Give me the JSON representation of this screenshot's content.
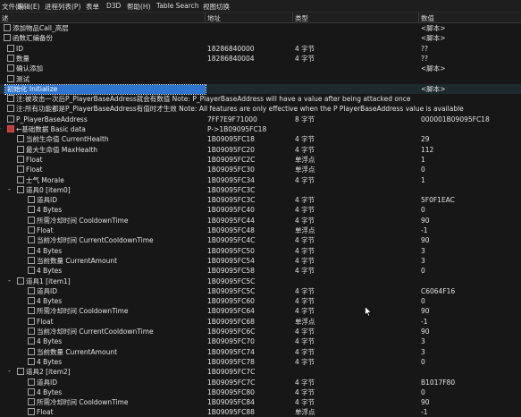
{
  "menubar": {
    "items": [
      {
        "key": "menu-file",
        "label": "文件(F)"
      },
      {
        "key": "menu-edit",
        "label": "编辑(E)"
      },
      {
        "key": "menu-process-list",
        "label": "进程列表(P)"
      },
      {
        "key": "menu-form",
        "label": "表单"
      },
      {
        "key": "menu-d3d",
        "label": "D3D"
      },
      {
        "key": "menu-help",
        "label": "帮助(H)"
      },
      {
        "key": "menu-table-search",
        "label": "Table Search"
      },
      {
        "key": "menu-view-switch",
        "label": "视图切换"
      }
    ]
  },
  "columns": {
    "desc": "述",
    "address": "地址",
    "type": "类型",
    "value": "数值"
  },
  "rows": [
    {
      "desc": "添加物品Call_高层",
      "addr": "",
      "type": "",
      "val": "<脚本>",
      "cb": "unchecked",
      "exp": ""
    },
    {
      "desc": "函数汇编备份",
      "addr": "",
      "type": "",
      "val": "<脚本>",
      "cb": "unchecked",
      "exp": ""
    },
    {
      "desc": "ID",
      "addr": "18286840000",
      "type": "4 字节",
      "val": "??",
      "cb": "unchecked",
      "exp": ""
    },
    {
      "desc": "数量",
      "addr": "18286840004",
      "type": "4 字节",
      "val": "??",
      "cb": "unchecked",
      "exp": ""
    },
    {
      "desc": "确认添加",
      "addr": "",
      "type": "",
      "val": "<脚本>",
      "cb": "unchecked",
      "exp": ""
    },
    {
      "desc": "测试",
      "addr": "",
      "type": "",
      "val": "",
      "cb": "unchecked",
      "exp": ""
    },
    {
      "desc": "初始化 Initialize",
      "addr": "",
      "type": "",
      "val": "<脚本>",
      "cb": "none",
      "exp": ""
    },
    {
      "desc": "注:被攻击一次后P_PlayerBaseAddress就会有数值 Note: P_PlayerBaseAddress will have a value after being attacked once",
      "addr": "",
      "type": "",
      "val": "",
      "cb": "unchecked",
      "exp": ""
    },
    {
      "desc": "注:所有功能都是P_PlayerBaseAddress有值时才生效 Note: All features are only effective when the P PlayerBaseAddress value is available",
      "addr": "",
      "type": "",
      "val": "",
      "cb": "unchecked",
      "exp": ""
    },
    {
      "desc": "P_PlayerBaseAddress",
      "addr": "7FF7E9F71000",
      "type": "8 字节",
      "val": "000001B09095FC18",
      "cb": "unchecked",
      "exp": ""
    },
    {
      "desc": "←基础数据 Basic data",
      "addr": "P->1B09095FC18",
      "type": "",
      "val": "",
      "cb": "checked",
      "exp": "-"
    },
    {
      "desc": "当前生命值 CurrentHealth",
      "addr": "1B09095FC18",
      "type": "4 字节",
      "val": "29",
      "cb": "unchecked",
      "exp": ""
    },
    {
      "desc": "最大生命值 MaxHealth",
      "addr": "1B09095FC20",
      "type": "4 字节",
      "val": "112",
      "cb": "unchecked",
      "exp": ""
    },
    {
      "desc": "Float",
      "addr": "1B09095FC2C",
      "type": "单浮点",
      "val": "1",
      "cb": "unchecked",
      "exp": ""
    },
    {
      "desc": "Float",
      "addr": "1B09095FC30",
      "type": "单浮点",
      "val": "0",
      "cb": "unchecked",
      "exp": ""
    },
    {
      "desc": "士气 Morale",
      "addr": "1B09095FC34",
      "type": "4 字节",
      "val": "1",
      "cb": "unchecked",
      "exp": ""
    },
    {
      "desc": "道具0 [item0]",
      "addr": "1B09095FC3C",
      "type": "",
      "val": "",
      "cb": "unchecked",
      "exp": "-"
    },
    {
      "desc": "道具ID",
      "addr": "1B09095FC3C",
      "type": "4 字节",
      "val": "5F0F1EAC",
      "cb": "unchecked",
      "exp": ""
    },
    {
      "desc": "4 Bytes",
      "addr": "1B09095FC40",
      "type": "4 字节",
      "val": "0",
      "cb": "unchecked",
      "exp": ""
    },
    {
      "desc": "所需冷却时间 CooldownTime",
      "addr": "1B09095FC44",
      "type": "4 字节",
      "val": "90",
      "cb": "unchecked",
      "exp": ""
    },
    {
      "desc": "Float",
      "addr": "1B09095FC48",
      "type": "单浮点",
      "val": "-1",
      "cb": "unchecked",
      "exp": ""
    },
    {
      "desc": "当前冷却时间 CurrentCooldownTime",
      "addr": "1B09095FC4C",
      "type": "4 字节",
      "val": "90",
      "cb": "unchecked",
      "exp": ""
    },
    {
      "desc": "4 Bytes",
      "addr": "1B09095FC50",
      "type": "4 字节",
      "val": "3",
      "cb": "unchecked",
      "exp": ""
    },
    {
      "desc": "当前数量 CurrentAmount",
      "addr": "1B09095FC54",
      "type": "4 字节",
      "val": "3",
      "cb": "unchecked",
      "exp": ""
    },
    {
      "desc": "4 Bytes",
      "addr": "1B09095FC58",
      "type": "4 字节",
      "val": "0",
      "cb": "unchecked",
      "exp": ""
    },
    {
      "desc": "道具1 [item1]",
      "addr": "1B09095FC5C",
      "type": "",
      "val": "",
      "cb": "unchecked",
      "exp": "-"
    },
    {
      "desc": "道具ID",
      "addr": "1B09095FC5C",
      "type": "4 字节",
      "val": "C6064F16",
      "cb": "unchecked",
      "exp": ""
    },
    {
      "desc": "4 Bytes",
      "addr": "1B09095FC60",
      "type": "4 字节",
      "val": "0",
      "cb": "unchecked",
      "exp": ""
    },
    {
      "desc": "所需冷却时间 CooldownTime",
      "addr": "1B09095FC64",
      "type": "4 字节",
      "val": "90",
      "cb": "unchecked",
      "exp": ""
    },
    {
      "desc": "Float",
      "addr": "1B09095FC68",
      "type": "单浮点",
      "val": "-1",
      "cb": "unchecked",
      "exp": ""
    },
    {
      "desc": "当前冷却时间 CurrentCooldownTime",
      "addr": "1B09095FC6C",
      "type": "4 字节",
      "val": "90",
      "cb": "unchecked",
      "exp": ""
    },
    {
      "desc": "4 Bytes",
      "addr": "1B09095FC70",
      "type": "4 字节",
      "val": "3",
      "cb": "unchecked",
      "exp": ""
    },
    {
      "desc": "当前数量 CurrentAmount",
      "addr": "1B09095FC74",
      "type": "4 字节",
      "val": "3",
      "cb": "unchecked",
      "exp": ""
    },
    {
      "desc": "4 Bytes",
      "addr": "1B09095FC78",
      "type": "4 字节",
      "val": "0",
      "cb": "unchecked",
      "exp": ""
    },
    {
      "desc": "道具2 [item2]",
      "addr": "1B09095FC7C",
      "type": "",
      "val": "",
      "cb": "unchecked",
      "exp": "-"
    },
    {
      "desc": "道具ID",
      "addr": "1B09095FC7C",
      "type": "4 字节",
      "val": "B1017F80",
      "cb": "unchecked",
      "exp": ""
    },
    {
      "desc": "4 Bytes",
      "addr": "1B09095FC80",
      "type": "4 字节",
      "val": "0",
      "cb": "unchecked",
      "exp": ""
    },
    {
      "desc": "所需冷却时间 CooldownTime",
      "addr": "1B09095FC84",
      "type": "4 字节",
      "val": "90",
      "cb": "unchecked",
      "exp": ""
    },
    {
      "desc": "Float",
      "addr": "1B09095FC88",
      "type": "单浮点",
      "val": "-1",
      "cb": "unchecked",
      "exp": ""
    }
  ],
  "colors": {
    "background": "#171717",
    "text": "#e2e2e2",
    "selection": "#2f74cf",
    "checked_box": "#c23a3a",
    "highlight_row": "#1d2a2e"
  },
  "icons": {
    "cursor": "mouse-pointer-icon"
  }
}
